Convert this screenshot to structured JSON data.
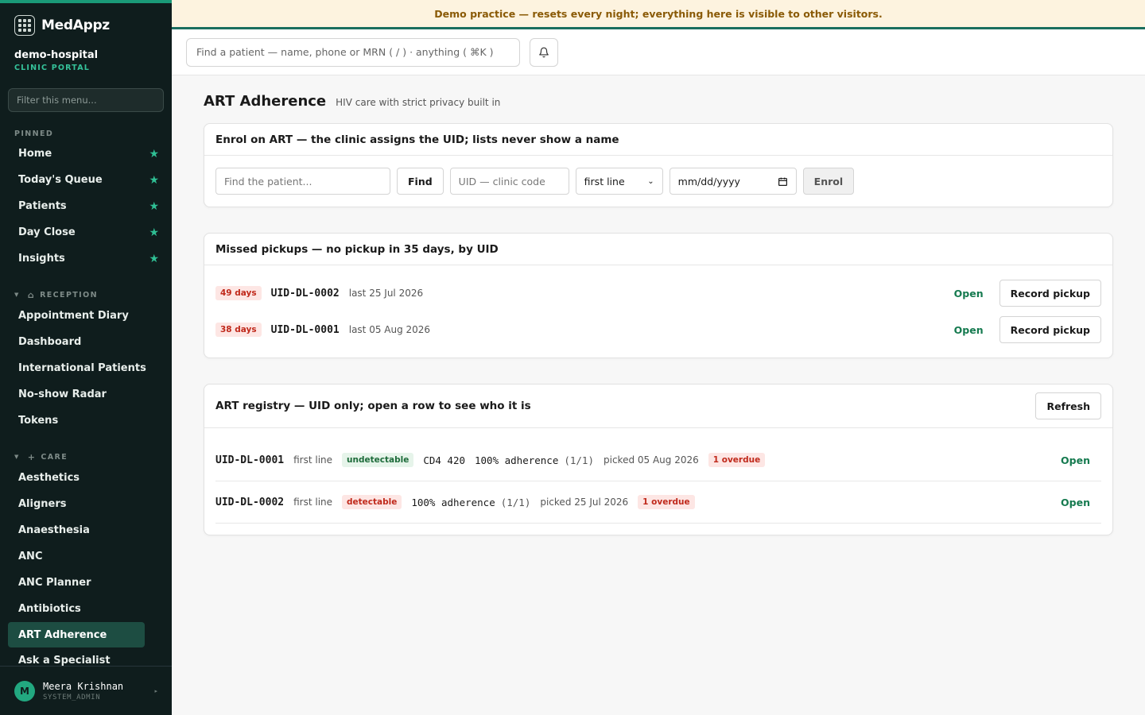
{
  "app": {
    "name": "MedAppz",
    "org_name": "demo-hospital",
    "org_sub": "CLINIC PORTAL"
  },
  "banner": "Demo practice — resets every night; everything here is visible to other visitors.",
  "sidebar": {
    "filter_placeholder": "Filter this menu...",
    "pinned_label": "PINNED",
    "pinned": [
      {
        "label": "Home"
      },
      {
        "label": "Today's Queue"
      },
      {
        "label": "Patients"
      },
      {
        "label": "Day Close"
      },
      {
        "label": "Insights"
      }
    ],
    "reception_label": "RECEPTION",
    "reception": [
      {
        "label": "Appointment Diary"
      },
      {
        "label": "Dashboard"
      },
      {
        "label": "International Patients"
      },
      {
        "label": "No-show Radar"
      },
      {
        "label": "Tokens"
      }
    ],
    "care_label": "CARE",
    "care": [
      {
        "label": "Aesthetics"
      },
      {
        "label": "Aligners"
      },
      {
        "label": "Anaesthesia"
      },
      {
        "label": "ANC"
      },
      {
        "label": "ANC Planner"
      },
      {
        "label": "Antibiotics"
      },
      {
        "label": "ART Adherence"
      },
      {
        "label": "Ask a Specialist"
      }
    ],
    "user": {
      "initial": "M",
      "name": "Meera Krishnan",
      "role": "SYSTEM_ADMIN"
    }
  },
  "topbar": {
    "search_placeholder": "Find a patient — name, phone or MRN ( / ) · anything ( ⌘K )"
  },
  "page": {
    "title": "ART Adherence",
    "subtitle": "HIV care with strict privacy built in"
  },
  "enrol": {
    "title": "Enrol on ART — the clinic assigns the UID; lists never show a name",
    "patient_placeholder": "Find the patient...",
    "find_label": "Find",
    "uid_placeholder": "UID — clinic code",
    "regimen": "first line",
    "date_placeholder": "mm/dd/yyyy",
    "enrol_label": "Enrol"
  },
  "missed": {
    "title": "Missed pickups — no pickup in 35 days, by UID",
    "rows": [
      {
        "days": "49 days",
        "uid": "UID-DL-0002",
        "last": "last 25 Jul 2026",
        "open": "Open",
        "action": "Record pickup"
      },
      {
        "days": "38 days",
        "uid": "UID-DL-0001",
        "last": "last 05 Aug 2026",
        "open": "Open",
        "action": "Record pickup"
      }
    ]
  },
  "registry": {
    "title": "ART registry — UID only; open a row to see who it is",
    "refresh_label": "Refresh",
    "rows": [
      {
        "uid": "UID-DL-0001",
        "line": "first line",
        "status": "undetectable",
        "cd4": "CD4 420",
        "adherence": "100% adherence",
        "ratio": "(1/1)",
        "picked": "picked 05 Aug 2026",
        "overdue": "1 overdue",
        "open": "Open"
      },
      {
        "uid": "UID-DL-0002",
        "line": "first line",
        "status": "detectable",
        "adherence": "100% adherence",
        "ratio": "(1/1)",
        "picked": "picked 25 Jul 2026",
        "overdue": "1 overdue",
        "open": "Open"
      }
    ]
  }
}
